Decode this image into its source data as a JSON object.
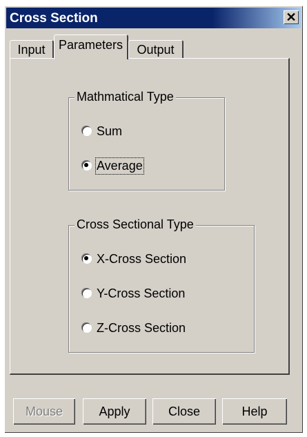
{
  "window": {
    "title": "Cross Section",
    "close_label": "✕"
  },
  "tabs": [
    {
      "label": "Input"
    },
    {
      "label": "Parameters"
    },
    {
      "label": "Output"
    }
  ],
  "math_group": {
    "legend": "Mathmatical Type",
    "options": [
      {
        "label": "Sum",
        "selected": false
      },
      {
        "label": "Average",
        "selected": true
      }
    ]
  },
  "section_group": {
    "legend": "Cross Sectional Type",
    "options": [
      {
        "label": "X-Cross Section",
        "selected": true
      },
      {
        "label": "Y-Cross Section",
        "selected": false
      },
      {
        "label": "Z-Cross Section",
        "selected": false
      }
    ]
  },
  "buttons": {
    "mouse": "Mouse",
    "apply": "Apply",
    "close": "Close",
    "help": "Help"
  }
}
